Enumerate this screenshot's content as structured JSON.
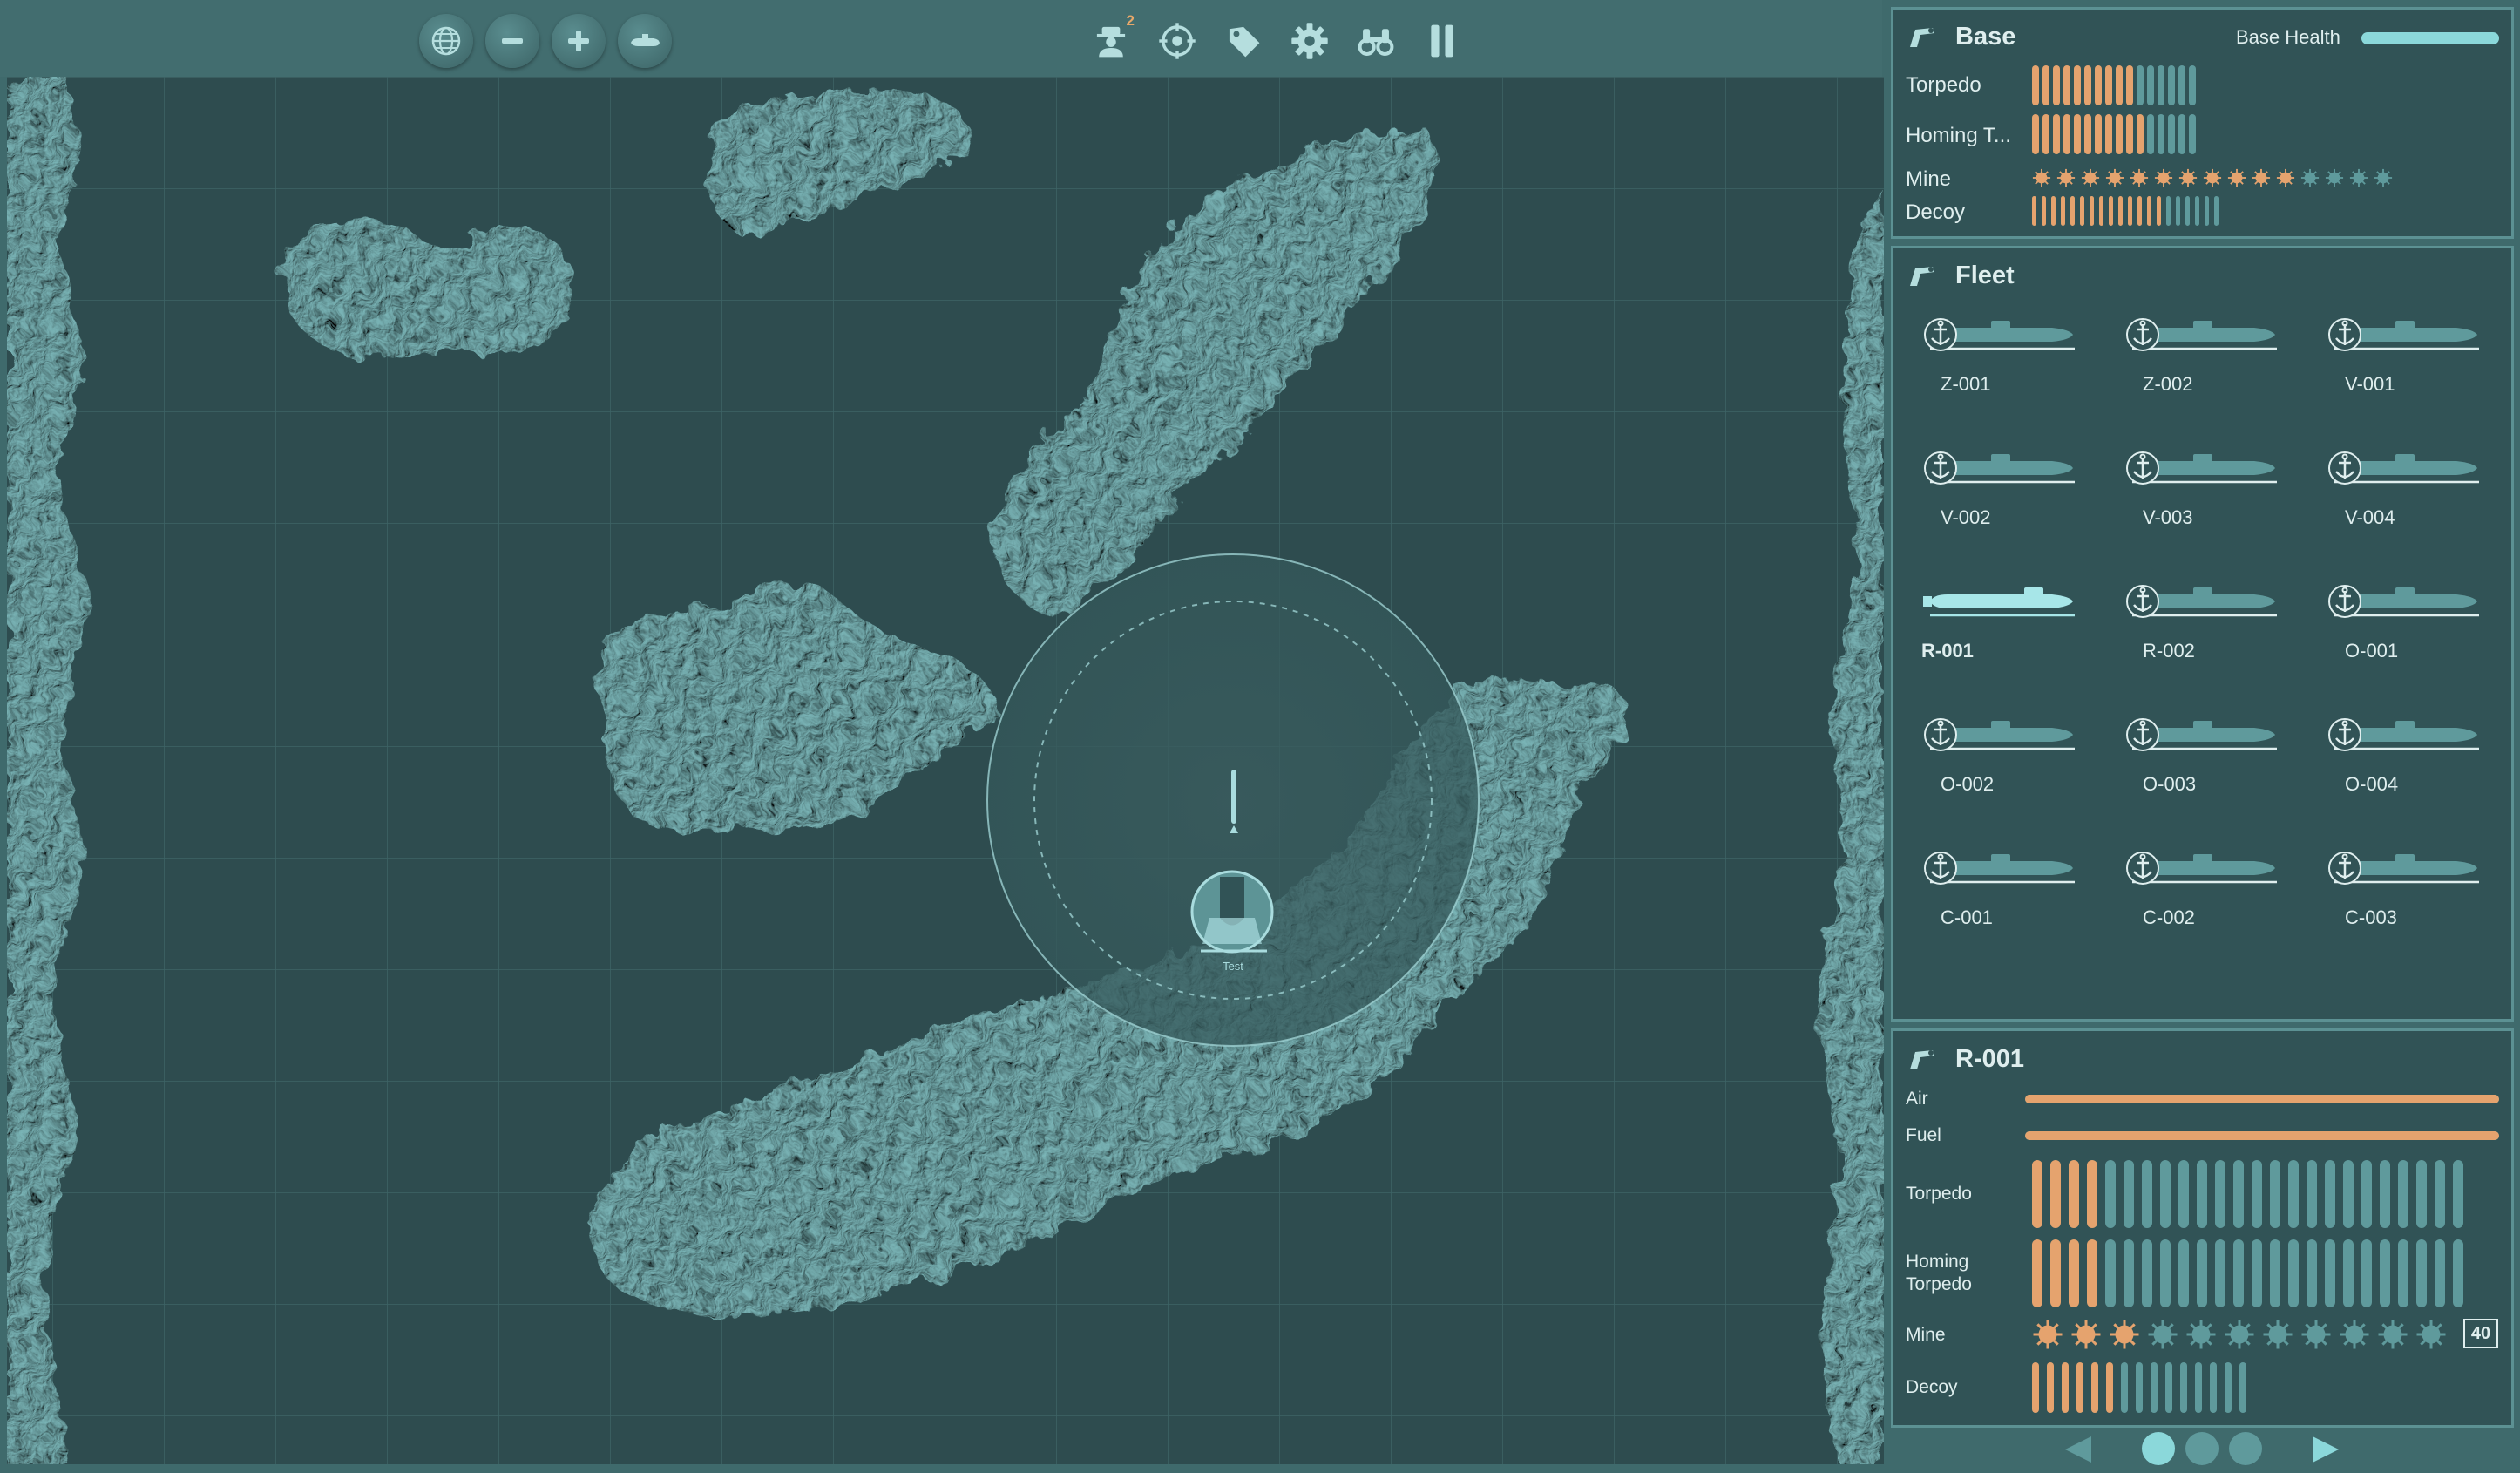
{
  "toolbar": {
    "left_icons": [
      "globe-icon",
      "minus-icon",
      "plus-icon",
      "submarine-icon"
    ],
    "right_icons": [
      "agent-icon",
      "target-icon",
      "tag-icon",
      "gear-icon",
      "binoculars-icon",
      "pause-icon"
    ],
    "agent_badge": "2"
  },
  "map": {
    "unit_label": "Test",
    "colors": {
      "sea": "#2e4c4f",
      "land": "#67a3a5",
      "grid": "#3d6466"
    }
  },
  "base": {
    "title": "Base",
    "health_label": "Base Health",
    "health": 1.0,
    "torpedo_label": "Torpedo",
    "torpedo": {
      "loaded": 10,
      "total": 16
    },
    "homing_label": "Homing T...",
    "homing": {
      "loaded": 11,
      "total": 16
    },
    "mine_label": "Mine",
    "mine": {
      "loaded": 11,
      "total": 15
    },
    "decoy_label": "Decoy",
    "decoy": {
      "loaded": 14,
      "total": 20
    }
  },
  "fleet": {
    "title": "Fleet",
    "units": [
      {
        "name": "Z-001",
        "selected": false
      },
      {
        "name": "Z-002",
        "selected": false
      },
      {
        "name": "V-001",
        "selected": false
      },
      {
        "name": "V-002",
        "selected": false
      },
      {
        "name": "V-003",
        "selected": false
      },
      {
        "name": "V-004",
        "selected": false
      },
      {
        "name": "R-001",
        "selected": true
      },
      {
        "name": "R-002",
        "selected": false
      },
      {
        "name": "O-001",
        "selected": false
      },
      {
        "name": "O-002",
        "selected": false
      },
      {
        "name": "O-003",
        "selected": false
      },
      {
        "name": "O-004",
        "selected": false
      },
      {
        "name": "C-001",
        "selected": false
      },
      {
        "name": "C-002",
        "selected": false
      },
      {
        "name": "C-003",
        "selected": false
      }
    ]
  },
  "unit": {
    "title": "R-001",
    "air_label": "Air",
    "air": 1.0,
    "fuel_label": "Fuel",
    "fuel": 1.0,
    "torpedo_label": "Torpedo",
    "torpedo": {
      "loaded": 4,
      "total": 24
    },
    "homing_label_1": "Homing",
    "homing_label_2": "Torpedo",
    "homing": {
      "loaded": 4,
      "total": 24
    },
    "mine_label": "Mine",
    "mine": {
      "loaded": 3,
      "total": 11
    },
    "mine_count": "40",
    "decoy_label": "Decoy",
    "decoy": {
      "loaded": 6,
      "total": 15
    }
  },
  "pager": {
    "pages": 3,
    "current": 1
  }
}
